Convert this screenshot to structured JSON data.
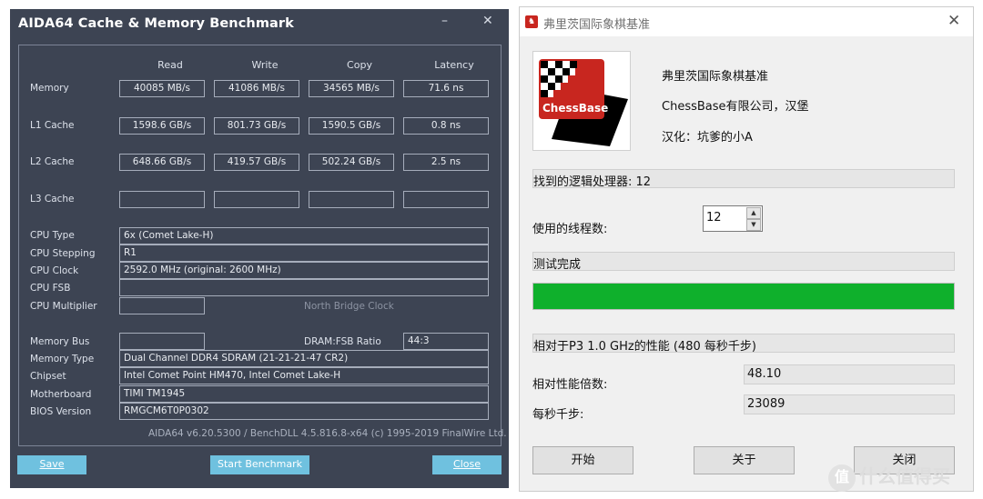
{
  "aida": {
    "title": "AIDA64 Cache & Memory Benchmark",
    "minimize": "–",
    "close_x": "✕",
    "columns": [
      "Read",
      "Write",
      "Copy",
      "Latency"
    ],
    "rows": [
      {
        "label": "Memory",
        "values": [
          "40085 MB/s",
          "41086 MB/s",
          "34565 MB/s",
          "71.6 ns"
        ]
      },
      {
        "label": "L1 Cache",
        "values": [
          "1598.6 GB/s",
          "801.73 GB/s",
          "1590.5 GB/s",
          "0.8 ns"
        ]
      },
      {
        "label": "L2 Cache",
        "values": [
          "648.66 GB/s",
          "419.57 GB/s",
          "502.24 GB/s",
          "2.5 ns"
        ]
      },
      {
        "label": "L3 Cache",
        "values": [
          "",
          "",
          "",
          ""
        ]
      }
    ],
    "cpu": {
      "type_label": "CPU Type",
      "type_value": "6x   (Comet Lake-H)",
      "stepping_label": "CPU Stepping",
      "stepping_value": "R1",
      "clock_label": "CPU Clock",
      "clock_value": "2592.0 MHz  (original: 2600 MHz)",
      "fsb_label": "CPU FSB",
      "fsb_value": "",
      "multiplier_label": "CPU Multiplier",
      "multiplier_value": "",
      "north_bridge_label": "North Bridge Clock"
    },
    "mem": {
      "bus_label": "Memory Bus",
      "bus_value": "",
      "ratio_label": "DRAM:FSB Ratio",
      "ratio_value": "44:3",
      "type_label": "Memory Type",
      "type_value": "Dual Channel DDR4 SDRAM  (21-21-21-47 CR2)",
      "chipset_label": "Chipset",
      "chipset_value": "Intel Comet Point HM470, Intel Comet Lake-H",
      "mobo_label": "Motherboard",
      "mobo_value": "TIMI TM1945",
      "bios_label": "BIOS Version",
      "bios_value": "RMGCM6T0P0302"
    },
    "footer": "AIDA64 v6.20.5300 / BenchDLL 4.5.816.8-x64  (c) 1995-2019 FinalWire Ltd.",
    "buttons": {
      "save": "Save",
      "start": "Start Benchmark",
      "close": "Close"
    },
    "colors": {
      "bg": "#3d4453",
      "button": "#6fc1df"
    }
  },
  "chess": {
    "title": "弗里茨国际象棋基准",
    "close_x": "✕",
    "logo_text": "ChessBase",
    "app_name": "弗里茨国际象棋基准",
    "company": "ChessBase有限公司，汉堡",
    "localized_by": "汉化：坑爹的小A",
    "processors_found": "找到的逻辑处理器: 12",
    "threads_label": "使用的线程数:",
    "threads_value": "12",
    "status": "测试完成",
    "progress": 1.0,
    "relative_perf": "相对于P3 1.0 GHz的性能 (480 每秒千步)",
    "factor_label": "相对性能倍数:",
    "factor_value": "48.10",
    "kns_label": "每秒千步:",
    "kns_value": "23089",
    "buttons": {
      "start": "开始",
      "about": "关于",
      "close": "关闭"
    },
    "colors": {
      "progress": "#0fb02c",
      "logo_red": "#c8261f"
    }
  },
  "watermark": {
    "icon": "值",
    "text": "什么值得买"
  }
}
